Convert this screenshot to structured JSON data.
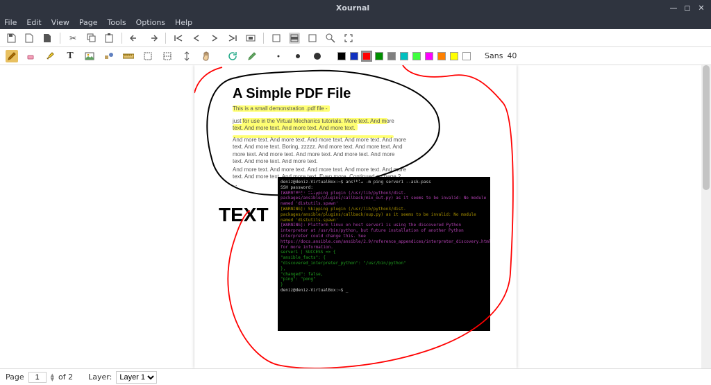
{
  "app": {
    "title": "Xournal"
  },
  "window_controls": {
    "minimize": "—",
    "maximize": "◻",
    "close": "✕"
  },
  "menu": {
    "items": [
      "File",
      "Edit",
      "View",
      "Page",
      "Tools",
      "Options",
      "Help"
    ]
  },
  "toolbar1": {
    "save": "save",
    "new": "new",
    "open": "open",
    "cut": "cut",
    "copy": "copy",
    "paste": "paste",
    "undo": "undo",
    "redo": "redo",
    "first": "first",
    "prev": "prev",
    "next": "next",
    "last": "last",
    "zoom_out": "zoom-out",
    "fit_page": "fit-page",
    "fit_width": "fit-width",
    "zoom_in": "zoom-in",
    "zoom": "zoom",
    "fullscreen": "fullscreen"
  },
  "toolbar2": {
    "tools": [
      "pencil",
      "eraser",
      "highlighter",
      "text",
      "image",
      "shapes",
      "ruler",
      "select-rect",
      "vspace",
      "hand"
    ],
    "extra": [
      "reload",
      "default-pen"
    ],
    "thickness": [
      "fine",
      "medium",
      "thick"
    ],
    "colors": [
      {
        "name": "black",
        "hex": "#000000",
        "selected": false
      },
      {
        "name": "blue",
        "hex": "#1030c0",
        "selected": false
      },
      {
        "name": "red",
        "hex": "#ff0000",
        "selected": true
      },
      {
        "name": "green",
        "hex": "#009000",
        "selected": false
      },
      {
        "name": "gray",
        "hex": "#808080",
        "selected": false
      },
      {
        "name": "cyan",
        "hex": "#00c0c0",
        "selected": false
      },
      {
        "name": "lime",
        "hex": "#40ff40",
        "selected": false
      },
      {
        "name": "magenta",
        "hex": "#ff00ff",
        "selected": false
      },
      {
        "name": "orange",
        "hex": "#ff8000",
        "selected": false
      },
      {
        "name": "yellow",
        "hex": "#ffff00",
        "selected": false
      },
      {
        "name": "white",
        "hex": "#ffffff",
        "selected": false
      }
    ],
    "font_family": "Sans",
    "font_size": "40"
  },
  "document": {
    "pdf_title": "A Simple PDF File",
    "para1": "This is a small demonstration .pdf file -",
    "para2": "just for use in the Virtual Mechanics tutorials. More text. And more text. And more text. And more text. And more text.",
    "para3": "And more text. And more text. And more text. And more text. And more text. And more text. Boring, zzzzz. And more text. And more text. And more text. And more text. And more text. And more text. And more text. And more text. And more text.",
    "para4": "And more text. And more text. And more text. And more text. And more text. And more text. And more text. Even more. Continued on page 2 ...",
    "text_tool_value": "TEXT",
    "terminal_lines": [
      {
        "cls": "tw",
        "txt": "deniz@deniz-VirtualBox:~$ ansible -m ping server1 --ask-pass"
      },
      {
        "cls": "tw",
        "txt": "SSH password:"
      },
      {
        "cls": "tm",
        "txt": "[WARNING]: Skipping plugin (/usr/lib/python3/dist-packages/ansible/plugins/callback/mix_out.py) as it seems to be invalid: No module named 'distutils.spawn'"
      },
      {
        "cls": "ty",
        "txt": "[WARNING]: Skipping plugin (/usr/lib/python3/dist-packages/ansible/plugins/callback/oup.py) as it seems to be invalid: No module named 'distutils.spawn'"
      },
      {
        "cls": "tm",
        "txt": "[WARNING]: Platform linux on host server1 is using the discovered Python interpreter at /usr/bin/python, but future installation of another Python interpreter could change this. See https://docs.ansible.com/ansible/2.9/reference_appendices/interpreter_discovery.html for more information."
      },
      {
        "cls": "tg",
        "txt": "server1 | SUCCESS => {"
      },
      {
        "cls": "tg",
        "txt": "    \"ansible_facts\": {"
      },
      {
        "cls": "tg",
        "txt": "        \"discovered_interpreter_python\": \"/usr/bin/python\""
      },
      {
        "cls": "tg",
        "txt": "    },"
      },
      {
        "cls": "tg",
        "txt": "    \"changed\": false,"
      },
      {
        "cls": "tg",
        "txt": "    \"ping\": \"pong\""
      },
      {
        "cls": "tg",
        "txt": "}"
      },
      {
        "cls": "tw",
        "txt": "deniz@deniz-VirtualBox:~$ _"
      }
    ]
  },
  "status": {
    "page_label": "Page",
    "page_current": "1",
    "page_of": "of 2",
    "layer_label": "Layer:",
    "layer_value": "Layer 1"
  }
}
